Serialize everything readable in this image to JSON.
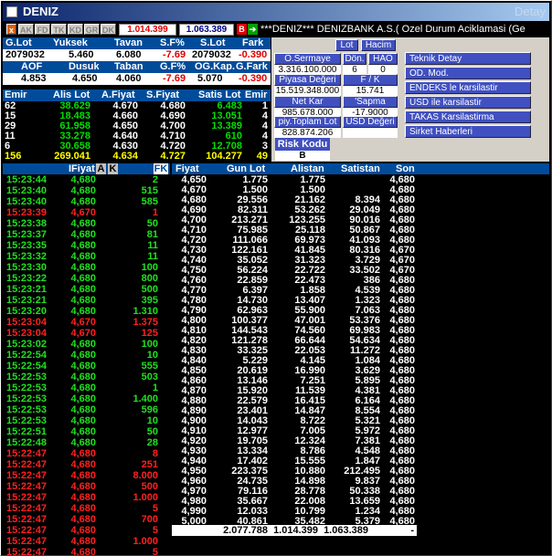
{
  "window": {
    "title": "DENIZ",
    "right_label": "Detay"
  },
  "toolbar": {
    "buttons": [
      "AK",
      "FD",
      "TK",
      "KD",
      "GR",
      "DK"
    ],
    "bid": "1.014.399",
    "ask": "1.063.389",
    "buy": "B",
    "sell": "S",
    "marquee": "***DENIZ*** DENIZBANK A.S.( Ozel Durum Aciklamasi (Ge"
  },
  "summary": {
    "row1_headers": [
      "G.Lot",
      "Yuksek",
      "Tavan",
      "S.F%",
      "S.Lot",
      "Fark"
    ],
    "row1_values": [
      "2079032",
      "5.460",
      "6.080",
      "-7.69",
      "2079032",
      "-0.390"
    ],
    "row2_headers": [
      "AOF",
      "Dusuk",
      "Taban",
      "G.F%",
      "OG.Kap.",
      "G.Fark"
    ],
    "row2_values": [
      "4.853",
      "4.650",
      "4.060",
      "-7.69",
      "5.070",
      "-0.390"
    ]
  },
  "depth": {
    "headers": [
      "Emir",
      "Alis Lot",
      "A.Fiyat",
      "S.Fiyat",
      "Satis Lot",
      "Emir"
    ],
    "rows": [
      [
        "62",
        "38.629",
        "4.670",
        "4.680",
        "6.483",
        "1"
      ],
      [
        "15",
        "18.483",
        "4.660",
        "4.690",
        "13.051",
        "4"
      ],
      [
        "29",
        "61.958",
        "4.650",
        "4.700",
        "13.389",
        "4"
      ],
      [
        "11",
        "33.278",
        "4.640",
        "4.710",
        "610",
        "4"
      ],
      [
        "6",
        "30.658",
        "4.630",
        "4.720",
        "12.708",
        "3"
      ],
      [
        "156",
        "269.041",
        "4.634",
        "4.727",
        "104.277",
        "49"
      ]
    ]
  },
  "market": {
    "buttons": [
      "Lot",
      "Hacim"
    ],
    "labels": [
      "O.Sermaye",
      "Dön.",
      "HAO",
      "Piyasa Değeri",
      "F / K",
      "Net Kar",
      "'Sapma",
      "piy.Toplam Lot",
      "USD Değeri",
      "Risk Kodu"
    ],
    "values": [
      "3.316.100.000",
      "6",
      "0",
      "15.519.348.000",
      "15.741",
      "985.678.000",
      "-17.9000",
      "828.874.206",
      "",
      "B"
    ]
  },
  "links": [
    "Teknik Detay",
    "OD. Mod.",
    "ENDEKS le karsilastir",
    "USD ile karsilastir",
    "TAKAS Karsilastirma",
    "Sirket Haberleri"
  ],
  "trades": {
    "headers": [
      "IFiyat",
      "A",
      "K",
      "FK"
    ],
    "rows": [
      [
        "15:23:44",
        "4,680",
        "2",
        "g"
      ],
      [
        "15:23:40",
        "4,680",
        "515",
        "g"
      ],
      [
        "15:23:40",
        "4,680",
        "585",
        "g"
      ],
      [
        "15:23:39",
        "4,670",
        "1",
        "r"
      ],
      [
        "15:23:38",
        "4,680",
        "50",
        "g"
      ],
      [
        "15:23:37",
        "4,680",
        "81",
        "g"
      ],
      [
        "15:23:35",
        "4,680",
        "11",
        "g"
      ],
      [
        "15:23:32",
        "4,680",
        "11",
        "g"
      ],
      [
        "15:23:30",
        "4,680",
        "100",
        "g"
      ],
      [
        "15:23:22",
        "4,680",
        "800",
        "g"
      ],
      [
        "15:23:21",
        "4,680",
        "500",
        "g"
      ],
      [
        "15:23:21",
        "4,680",
        "395",
        "g"
      ],
      [
        "15:23:20",
        "4,680",
        "1.310",
        "g"
      ],
      [
        "15:23:04",
        "4,670",
        "1.375",
        "r"
      ],
      [
        "15:23:04",
        "4,670",
        "125",
        "r"
      ],
      [
        "15:23:02",
        "4,680",
        "100",
        "g"
      ],
      [
        "15:22:54",
        "4,680",
        "10",
        "g"
      ],
      [
        "15:22:54",
        "4,680",
        "555",
        "g"
      ],
      [
        "15:22:53",
        "4,680",
        "503",
        "g"
      ],
      [
        "15:22:53",
        "4,680",
        "1",
        "g"
      ],
      [
        "15:22:53",
        "4,680",
        "1.400",
        "g"
      ],
      [
        "15:22:53",
        "4,680",
        "596",
        "g"
      ],
      [
        "15:22:53",
        "4,680",
        "10",
        "g"
      ],
      [
        "15:22:51",
        "4,680",
        "50",
        "g"
      ],
      [
        "15:22:48",
        "4,680",
        "28",
        "g"
      ],
      [
        "15:22:47",
        "4,680",
        "8",
        "r"
      ],
      [
        "15:22:47",
        "4,680",
        "251",
        "r"
      ],
      [
        "15:22:47",
        "4,680",
        "8.000",
        "r"
      ],
      [
        "15:22:47",
        "4,680",
        "500",
        "r"
      ],
      [
        "15:22:47",
        "4,680",
        "1.000",
        "r"
      ],
      [
        "15:22:47",
        "4,680",
        "5",
        "r"
      ],
      [
        "15:22:47",
        "4,680",
        "700",
        "r"
      ],
      [
        "15:22:47",
        "4,680",
        "5",
        "r"
      ],
      [
        "15:22:47",
        "4,680",
        "1.000",
        "r"
      ],
      [
        "15:22:47",
        "4,680",
        "5",
        "r"
      ]
    ]
  },
  "levels": {
    "headers": [
      "Fiyat",
      "Gun Lot",
      "Alistan",
      "Satistan",
      "Son"
    ],
    "rows": [
      [
        "4,650",
        "1.775",
        "1.775",
        "",
        "4,680"
      ],
      [
        "4,670",
        "1.500",
        "1.500",
        "",
        "4,680"
      ],
      [
        "4,680",
        "29.556",
        "21.162",
        "8.394",
        "4,680"
      ],
      [
        "4,690",
        "82.311",
        "53.262",
        "29.049",
        "4,680"
      ],
      [
        "4,700",
        "213.271",
        "123.255",
        "90.016",
        "4,680"
      ],
      [
        "4,710",
        "75.985",
        "25.118",
        "50.867",
        "4,680"
      ],
      [
        "4,720",
        "111.066",
        "69.973",
        "41.093",
        "4,680"
      ],
      [
        "4,730",
        "122.161",
        "41.845",
        "80.316",
        "4,670"
      ],
      [
        "4,740",
        "35.052",
        "31.323",
        "3.729",
        "4,670"
      ],
      [
        "4,750",
        "56.224",
        "22.722",
        "33.502",
        "4,670"
      ],
      [
        "4,760",
        "22.859",
        "22.473",
        "386",
        "4,680"
      ],
      [
        "4,770",
        "6.397",
        "1.858",
        "4.539",
        "4,680"
      ],
      [
        "4,780",
        "14.730",
        "13.407",
        "1.323",
        "4,680"
      ],
      [
        "4,790",
        "62.963",
        "55.900",
        "7.063",
        "4,680"
      ],
      [
        "4,800",
        "100.377",
        "47.001",
        "53.376",
        "4,680"
      ],
      [
        "4,810",
        "144.543",
        "74.560",
        "69.983",
        "4,680"
      ],
      [
        "4,820",
        "121.278",
        "66.644",
        "54.634",
        "4,680"
      ],
      [
        "4,830",
        "33.325",
        "22.053",
        "11.272",
        "4,680"
      ],
      [
        "4,840",
        "5.229",
        "4.145",
        "1.084",
        "4,680"
      ],
      [
        "4,850",
        "20.619",
        "16.990",
        "3.629",
        "4,680"
      ],
      [
        "4,860",
        "13.146",
        "7.251",
        "5.895",
        "4,680"
      ],
      [
        "4,870",
        "15.920",
        "11.539",
        "4.381",
        "4,680"
      ],
      [
        "4,880",
        "22.579",
        "16.415",
        "6.164",
        "4,680"
      ],
      [
        "4,890",
        "23.401",
        "14.847",
        "8.554",
        "4,680"
      ],
      [
        "4,900",
        "14.043",
        "8.722",
        "5.321",
        "4,680"
      ],
      [
        "4,910",
        "12.977",
        "7.005",
        "5.972",
        "4,680"
      ],
      [
        "4,920",
        "19.705",
        "12.324",
        "7.381",
        "4,680"
      ],
      [
        "4,930",
        "13.334",
        "8.786",
        "4.548",
        "4,680"
      ],
      [
        "4,940",
        "17.402",
        "15.555",
        "1.847",
        "4,680"
      ],
      [
        "4,950",
        "223.375",
        "10.880",
        "212.495",
        "4,680"
      ],
      [
        "4,960",
        "24.735",
        "14.898",
        "9.837",
        "4,680"
      ],
      [
        "4,970",
        "79.116",
        "28.778",
        "50.338",
        "4,680"
      ],
      [
        "4,980",
        "35.667",
        "22.008",
        "13.659",
        "4,680"
      ],
      [
        "4,990",
        "12.033",
        "10.799",
        "1.234",
        "4,680"
      ],
      [
        "5,000",
        "40.861",
        "35.482",
        "5.379",
        "4,680"
      ]
    ],
    "totals": [
      "2.077.788",
      "1.014.399",
      "1.063.389",
      "-"
    ]
  }
}
